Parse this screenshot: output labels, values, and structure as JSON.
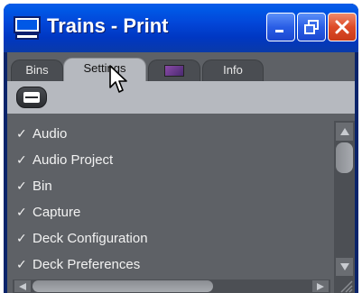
{
  "window": {
    "title": "Trains - Print"
  },
  "tabs": [
    {
      "label": "Bins"
    },
    {
      "label": "Settings"
    },
    {
      "label": ""
    },
    {
      "label": "Info"
    }
  ],
  "active_tab": "Settings",
  "settings_list": [
    {
      "label": "Audio",
      "checked": true
    },
    {
      "label": "Audio Project",
      "checked": true
    },
    {
      "label": "Bin",
      "checked": true
    },
    {
      "label": "Capture",
      "checked": true
    },
    {
      "label": "Deck Configuration",
      "checked": true
    },
    {
      "label": "Deck Preferences",
      "checked": true
    }
  ],
  "check_glyph": "✓",
  "icons": {
    "app": "computer-monitor-icon",
    "minimize": "minimize-icon",
    "restore": "restore-icon",
    "close": "close-icon",
    "list_view": "list-view-icon",
    "tab_swatch": "color-swatch-icon",
    "cursor": "mouse-pointer-icon"
  },
  "colors": {
    "titlebar": "#0058e6",
    "close_button": "#dd4b28",
    "panel_bg": "#5e6166",
    "active_tab": "#b6b9bf",
    "swatch": "#8a4aa8"
  }
}
